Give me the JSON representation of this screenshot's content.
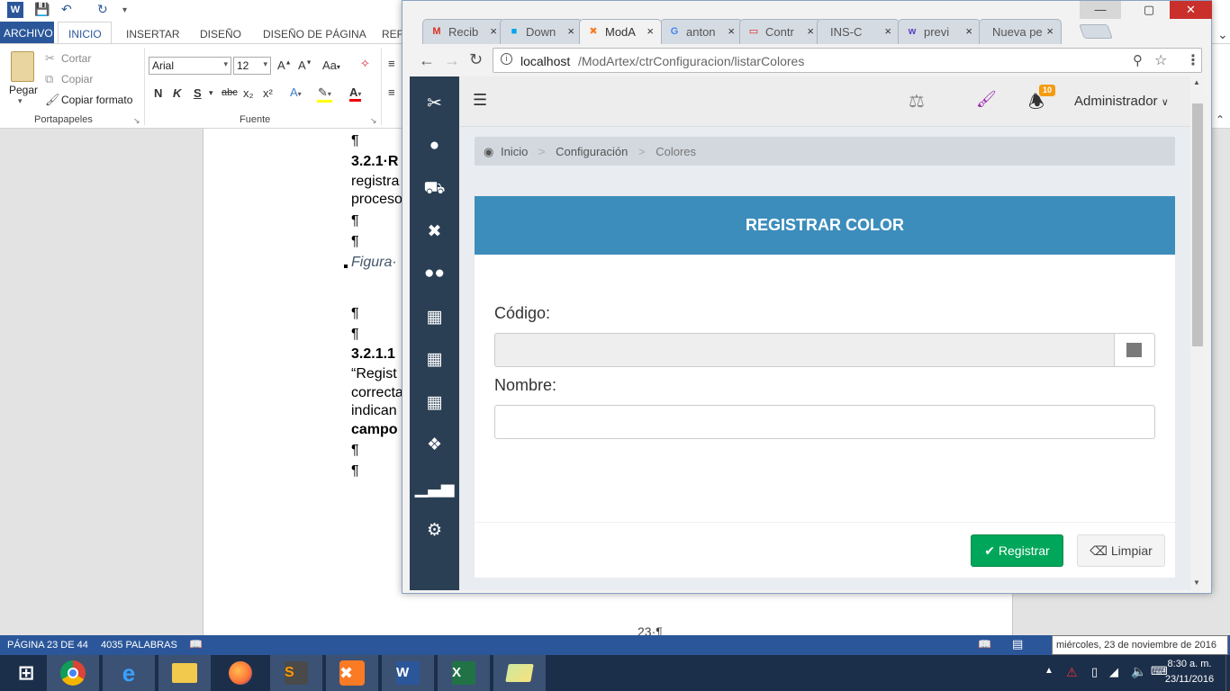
{
  "word": {
    "quick_access": {
      "save_icon": "save-icon",
      "undo_icon": "undo-icon",
      "redo_icon": "redo-icon"
    },
    "tabs": [
      "ARCHIVO",
      "INICIO",
      "INSERTAR",
      "DISEÑO",
      "DISEÑO DE PÁGINA",
      "REFE"
    ],
    "clipboard": {
      "paste": "Pegar",
      "cut": "Cortar",
      "copy": "Copiar",
      "format_painter": "Copiar formato",
      "group": "Portapapeles"
    },
    "font": {
      "family": "Arial",
      "size": "12",
      "group": "Fuente",
      "bold": "N",
      "italic": "K",
      "underline": "S",
      "strike": "abc",
      "subscript": "x₂",
      "superscript": "x²",
      "case": "Aa"
    },
    "document_lines": [
      {
        "text": "¶",
        "bold": false,
        "italic": false
      },
      {
        "text": "3.2.1·R",
        "bold": true,
        "italic": false
      },
      {
        "text": "registra",
        "bold": false,
        "italic": false
      },
      {
        "text": "proceso",
        "bold": false,
        "italic": false
      },
      {
        "text": "¶",
        "bold": false,
        "italic": false
      },
      {
        "text": "¶",
        "bold": false,
        "italic": false
      },
      {
        "text": "Figura·",
        "bold": false,
        "italic": true
      },
      {
        "text": "¶",
        "bold": false,
        "italic": false
      },
      {
        "text": "¶",
        "bold": false,
        "italic": false
      },
      {
        "text": "3.2.1.1",
        "bold": true,
        "italic": false
      },
      {
        "text": "“Regist",
        "bold": false,
        "italic": false
      },
      {
        "text": "correcta",
        "bold": false,
        "italic": false
      },
      {
        "text": "indican",
        "bold": false,
        "italic": false
      },
      {
        "text": "campo",
        "bold": true,
        "italic": false
      },
      {
        "text": "¶",
        "bold": false,
        "italic": false
      },
      {
        "text": "¶",
        "bold": false,
        "italic": false
      }
    ],
    "page_footer": "23·¶",
    "status": {
      "page": "PÁGINA 23 DE 44",
      "words": "4035 PALABRAS"
    },
    "tooltip_date": "miércoles, 23 de noviembre de 2016"
  },
  "browser": {
    "tabs": [
      {
        "label": "Recib",
        "icon": "gmail-icon",
        "active": false
      },
      {
        "label": "Down",
        "icon": "windows-icon",
        "active": false
      },
      {
        "label": "ModA",
        "icon": "xampp-icon",
        "active": true
      },
      {
        "label": "anton",
        "icon": "google-icon",
        "active": false
      },
      {
        "label": "Contr",
        "icon": "oracle-icon",
        "active": false
      },
      {
        "label": "INS-C",
        "icon": "",
        "active": false
      },
      {
        "label": "previ",
        "icon": "wr-icon",
        "active": false
      },
      {
        "label": "Nueva pe",
        "icon": "",
        "active": false
      }
    ],
    "url_host": "localhost",
    "url_path": "/ModArtex/ctrConfiguracion/listarColores"
  },
  "app": {
    "user": "Administrador",
    "notifications": "10",
    "breadcrumb": [
      "Inicio",
      "Configuración",
      "Colores"
    ],
    "panel_title": "REGISTRAR COLOR",
    "form": {
      "code_label": "Código:",
      "code_value": "",
      "name_label": "Nombre:",
      "name_value": "",
      "swatch_color": "#7a7a7a"
    },
    "buttons": {
      "register": "Registrar",
      "clear": "Limpiar"
    },
    "sidebar_icons": [
      "scissors-icon",
      "user-icon",
      "truck-icon",
      "puzzle-icon",
      "users-icon",
      "calculator-icon",
      "calendar-icon",
      "calendar-alt-icon",
      "dropbox-icon",
      "signal-icon",
      "cogs-icon"
    ]
  },
  "taskbar": {
    "time": "8:30 a. m.",
    "date": "23/11/2016",
    "apps": [
      "windows-start-icon",
      "chrome-icon",
      "ie-icon",
      "file-explorer-icon",
      "firefox-icon",
      "sublime-icon",
      "xampp-icon",
      "word-icon",
      "excel-icon",
      "folder-icon"
    ]
  },
  "colors": {
    "word_blue": "#2b579a",
    "sidebar": "#2a3f54",
    "panel_head": "#3c8dbc",
    "btn_success": "#00a65a",
    "badge": "#f39c12"
  }
}
